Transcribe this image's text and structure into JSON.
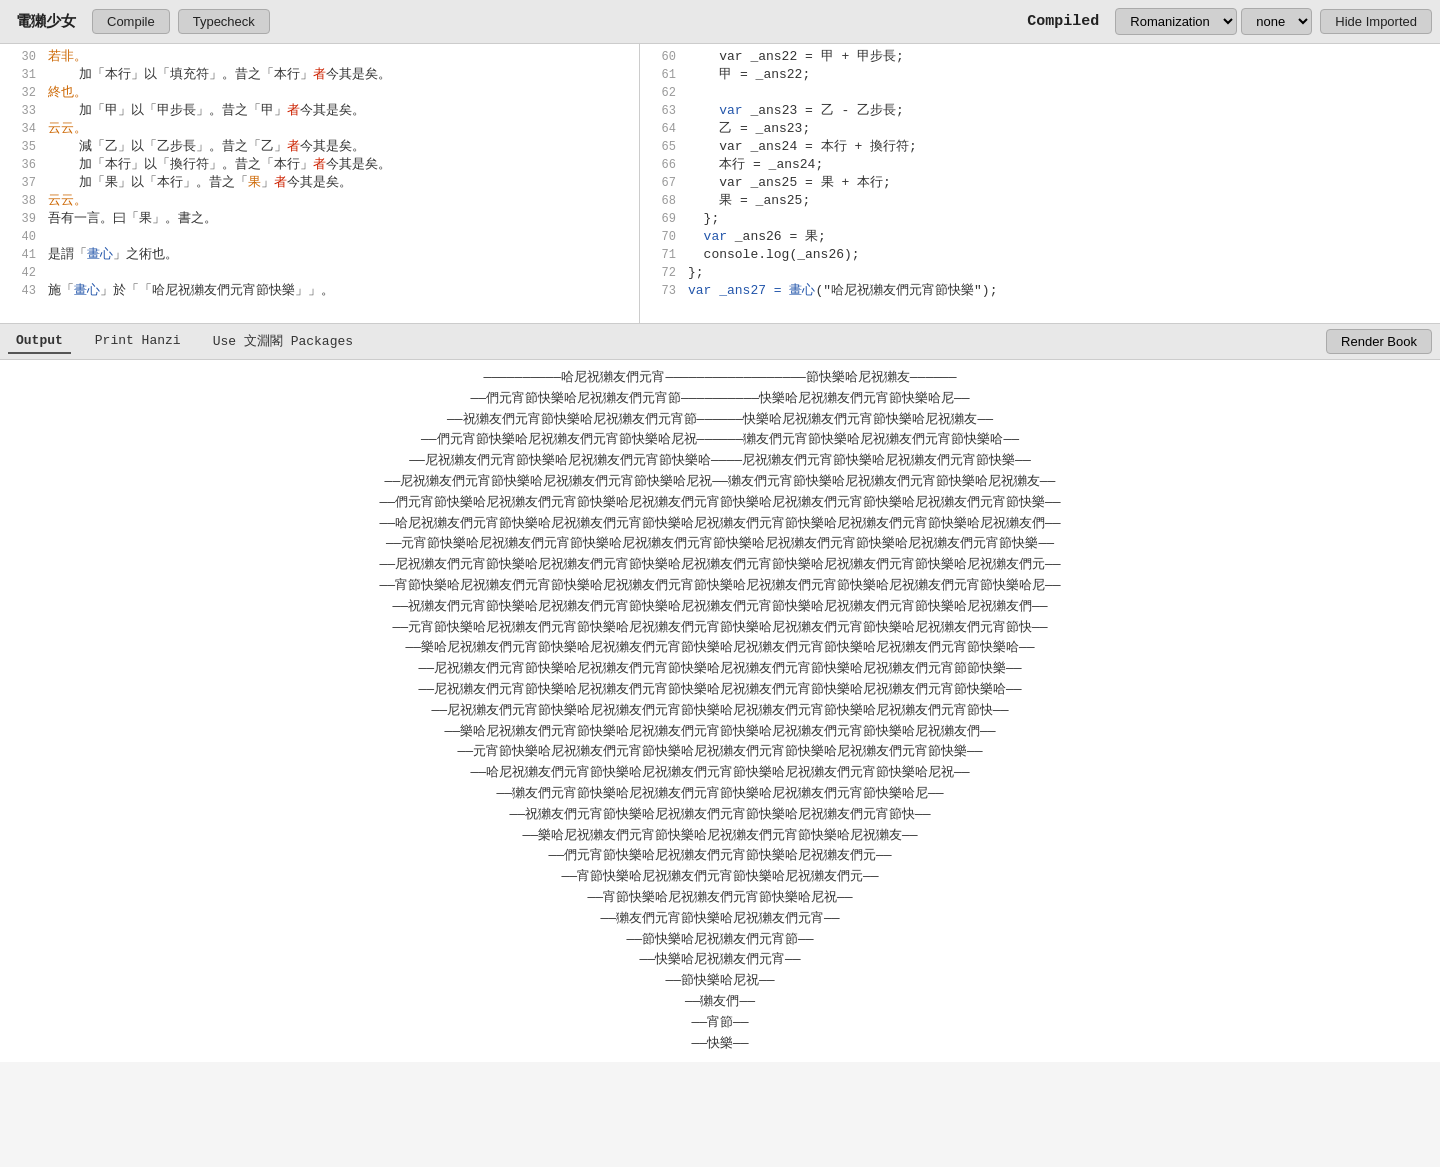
{
  "app": {
    "title": "電獺少女",
    "compile_btn": "Compile",
    "typecheck_btn": "Typecheck"
  },
  "compiled_panel": {
    "label": "Compiled",
    "romanization_label": "Romanization",
    "romanization_value": "none",
    "hide_imported_btn": "Hide Imported"
  },
  "left_editor": {
    "lines": [
      {
        "num": 30,
        "parts": [
          {
            "text": "若非。",
            "class": "kw-orange"
          }
        ]
      },
      {
        "num": 31,
        "parts": [
          {
            "text": "    加「本行」以「填充符」。昔之「本行」",
            "class": ""
          },
          {
            "text": "者",
            "class": "kw-red"
          },
          {
            "text": "今其是矣。",
            "class": ""
          }
        ]
      },
      {
        "num": 32,
        "parts": [
          {
            "text": "終也。",
            "class": "kw-orange"
          }
        ]
      },
      {
        "num": 33,
        "parts": [
          {
            "text": "    加「甲」以「甲步長」。昔之「甲」",
            "class": ""
          },
          {
            "text": "者",
            "class": "kw-red"
          },
          {
            "text": "今其是矣。",
            "class": ""
          }
        ]
      },
      {
        "num": 34,
        "parts": [
          {
            "text": "云云。",
            "class": "kw-orange"
          }
        ]
      },
      {
        "num": 35,
        "parts": [
          {
            "text": "    減「乙」以「乙步長」。昔之「乙」",
            "class": ""
          },
          {
            "text": "者",
            "class": "kw-red"
          },
          {
            "text": "今其是矣。",
            "class": ""
          }
        ]
      },
      {
        "num": 36,
        "parts": [
          {
            "text": "    加「本行」以「換行符」。昔之「本行」",
            "class": ""
          },
          {
            "text": "者",
            "class": "kw-red"
          },
          {
            "text": "今其是矣。",
            "class": ""
          }
        ]
      },
      {
        "num": 37,
        "parts": [
          {
            "text": "    加「果」以「本行」。昔之「",
            "class": ""
          },
          {
            "text": "果",
            "class": "kw-orange"
          },
          {
            "text": "」",
            "class": ""
          },
          {
            "text": "者",
            "class": "kw-red"
          },
          {
            "text": "今其是矣。",
            "class": ""
          }
        ]
      },
      {
        "num": 38,
        "parts": [
          {
            "text": "云云。",
            "class": "kw-orange"
          }
        ]
      },
      {
        "num": 39,
        "parts": [
          {
            "text": "吾有一言。曰「果」。書之。",
            "class": ""
          }
        ]
      },
      {
        "num": 40,
        "parts": []
      },
      {
        "num": 41,
        "parts": [
          {
            "text": "是謂「",
            "class": ""
          },
          {
            "text": "畫心",
            "class": "kw-blue"
          },
          {
            "text": "」之術也。",
            "class": ""
          }
        ]
      },
      {
        "num": 42,
        "parts": []
      },
      {
        "num": 43,
        "parts": [
          {
            "text": "施「",
            "class": ""
          },
          {
            "text": "畫心",
            "class": "kw-blue"
          },
          {
            "text": "」於「「哈尼祝獺友們元宵節快樂」」。",
            "class": ""
          }
        ]
      }
    ]
  },
  "right_editor": {
    "lines": [
      {
        "num": 60,
        "parts": [
          {
            "text": "    var _ans22 = 甲 + 甲步長;",
            "class": ""
          }
        ]
      },
      {
        "num": 61,
        "parts": [
          {
            "text": "    甲 = _ans22;",
            "class": ""
          }
        ]
      },
      {
        "num": 62,
        "parts": []
      },
      {
        "num": 63,
        "parts": [
          {
            "text": "    ",
            "class": ""
          },
          {
            "text": "var",
            "class": "kw-blue"
          },
          {
            "text": " _ans23 = 乙 - 乙步長;",
            "class": ""
          }
        ]
      },
      {
        "num": 64,
        "parts": [
          {
            "text": "    乙 = _ans23;",
            "class": ""
          }
        ]
      },
      {
        "num": 65,
        "parts": [
          {
            "text": "    var _ans24 = 本行 + 換行符;",
            "class": ""
          }
        ]
      },
      {
        "num": 66,
        "parts": [
          {
            "text": "    本行 = _ans24;",
            "class": ""
          }
        ]
      },
      {
        "num": 67,
        "parts": [
          {
            "text": "    var _ans25 = 果 + 本行;",
            "class": ""
          }
        ]
      },
      {
        "num": 68,
        "parts": [
          {
            "text": "    果 = _ans25;",
            "class": ""
          }
        ]
      },
      {
        "num": 69,
        "parts": [
          {
            "text": "  };",
            "class": ""
          }
        ]
      },
      {
        "num": 70,
        "parts": [
          {
            "text": "  ",
            "class": ""
          },
          {
            "text": "var",
            "class": "kw-blue"
          },
          {
            "text": " _ans26 = 果;",
            "class": ""
          }
        ]
      },
      {
        "num": 71,
        "parts": [
          {
            "text": "  console.log(_ans26);",
            "class": ""
          }
        ]
      },
      {
        "num": 72,
        "parts": [
          {
            "text": "};",
            "class": ""
          }
        ]
      },
      {
        "num": 73,
        "parts": [
          {
            "text": "var _ans27 = ",
            "class": "kw-blue"
          },
          {
            "text": "畫心",
            "class": "kw-blue"
          },
          {
            "text": "(\"哈尼祝獺友們元宵節快樂\");",
            "class": ""
          }
        ]
      }
    ]
  },
  "bottom_toolbar": {
    "tabs": [
      {
        "label": "Output",
        "active": true
      },
      {
        "label": "Print Hanzi",
        "active": false
      },
      {
        "label": "Use 文淵閣 Packages",
        "active": false
      }
    ],
    "render_btn": "Render Book"
  },
  "output": {
    "lines": [
      "——————————哈尼祝獺友們元宵——————————————————節快樂哈尼祝獺友——————",
      "——們元宵節快樂哈尼祝獺友們元宵節——————————快樂哈尼祝獺友們元宵節快樂哈尼——",
      "——祝獺友們元宵節快樂哈尼祝獺友們元宵節——————快樂哈尼祝獺友們元宵節快樂哈尼祝獺友——",
      "——們元宵節快樂哈尼祝獺友們元宵節快樂哈尼祝——————獺友們元宵節快樂哈尼祝獺友們元宵節快樂哈——",
      "——尼祝獺友們元宵節快樂哈尼祝獺友們元宵節快樂哈————尼祝獺友們元宵節快樂哈尼祝獺友們元宵節快樂——",
      "——尼祝獺友們元宵節快樂哈尼祝獺友們元宵節快樂哈尼祝——獺友們元宵節快樂哈尼祝獺友們元宵節快樂哈尼祝獺友——",
      "——們元宵節快樂哈尼祝獺友們元宵節快樂哈尼祝獺友們元宵節快樂哈尼祝獺友們元宵節快樂哈尼祝獺友們元宵節快樂——",
      "——哈尼祝獺友們元宵節快樂哈尼祝獺友們元宵節快樂哈尼祝獺友們元宵節快樂哈尼祝獺友們元宵節快樂哈尼祝獺友們——",
      "——元宵節快樂哈尼祝獺友們元宵節快樂哈尼祝獺友們元宵節快樂哈尼祝獺友們元宵節快樂哈尼祝獺友們元宵節快樂——",
      "——尼祝獺友們元宵節快樂哈尼祝獺友們元宵節快樂哈尼祝獺友們元宵節快樂哈尼祝獺友們元宵節快樂哈尼祝獺友們元——",
      "——宵節快樂哈尼祝獺友們元宵節快樂哈尼祝獺友們元宵節快樂哈尼祝獺友們元宵節快樂哈尼祝獺友們元宵節快樂哈尼——",
      "——祝獺友們元宵節快樂哈尼祝獺友們元宵節快樂哈尼祝獺友們元宵節快樂哈尼祝獺友們元宵節快樂哈尼祝獺友們——",
      "——元宵節快樂哈尼祝獺友們元宵節快樂哈尼祝獺友們元宵節快樂哈尼祝獺友們元宵節快樂哈尼祝獺友們元宵節快——",
      "——樂哈尼祝獺友們元宵節快樂哈尼祝獺友們元宵節快樂哈尼祝獺友們元宵節快樂哈尼祝獺友們元宵節快樂哈——",
      "——尼祝獺友們元宵節快樂哈尼祝獺友們元宵節快樂哈尼祝獺友們元宵節快樂哈尼祝獺友們元宵節節快樂——",
      "——尼祝獺友們元宵節快樂哈尼祝獺友們元宵節快樂哈尼祝獺友們元宵節快樂哈尼祝獺友們元宵節快樂哈——",
      "——尼祝獺友們元宵節快樂哈尼祝獺友們元宵節快樂哈尼祝獺友們元宵節快樂哈尼祝獺友們元宵節快——",
      "——樂哈尼祝獺友們元宵節快樂哈尼祝獺友們元宵節快樂哈尼祝獺友們元宵節快樂哈尼祝獺友們——",
      "——元宵節快樂哈尼祝獺友們元宵節快樂哈尼祝獺友們元宵節快樂哈尼祝獺友們元宵節快樂——",
      "——哈尼祝獺友們元宵節快樂哈尼祝獺友們元宵節快樂哈尼祝獺友們元宵節快樂哈尼祝——",
      "——獺友們元宵節快樂哈尼祝獺友們元宵節快樂哈尼祝獺友們元宵節快樂哈尼——",
      "——祝獺友們元宵節快樂哈尼祝獺友們元宵節快樂哈尼祝獺友們元宵節快——",
      "——樂哈尼祝獺友們元宵節快樂哈尼祝獺友們元宵節快樂哈尼祝獺友——",
      "——們元宵節快樂哈尼祝獺友們元宵節快樂哈尼祝獺友們元——",
      "——宵節快樂哈尼祝獺友們元宵節快樂哈尼祝獺友們元——",
      "——宵節快樂哈尼祝獺友們元宵節快樂哈尼祝——",
      "——獺友們元宵節快樂哈尼祝獺友們元宵——",
      "——節快樂哈尼祝獺友們元宵節——",
      "——快樂哈尼祝獺友們元宵——",
      "——節快樂哈尼祝——",
      "——獺友們——",
      "——宵節——",
      "——快樂——"
    ]
  }
}
